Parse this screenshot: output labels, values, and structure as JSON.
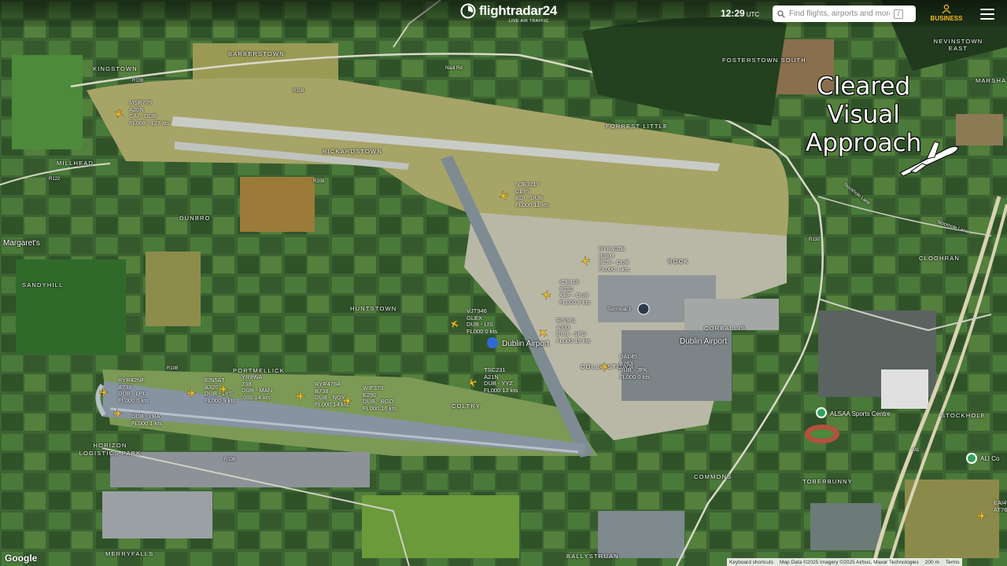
{
  "header": {
    "brand": "flightradar24",
    "tagline": "LIVE AIR TRAFFIC",
    "time": "12:29",
    "time_zone": "UTC",
    "search_placeholder": "Find flights, airports and more",
    "search_shortcut": "/",
    "business_label": "BUSINESS"
  },
  "overlay": {
    "line1": "Cleared",
    "line2": "Visual",
    "line3": "Approach"
  },
  "places": [
    "BARBERSTOWN",
    "KINGSTOWN",
    "FOSTERSTOWN SOUTH",
    "NEVINSTOWN EAST",
    "MARSHA",
    "FORREST LITTLE",
    "RICKARDSTOWN",
    "MILLHEAD",
    "DUNBRO",
    "Margaret's",
    "SANDYHILL",
    "HUNTSTOWN",
    "ROCK",
    "CLOGHRAN",
    "Terminal 1",
    "CORBALLIS",
    "Dublin Airport",
    "Dublin Airport",
    "COLLINSTOWN",
    "PORTMELLICK",
    "COLTRY",
    "HORIZON LOGISTICS PARK",
    "COMMONS",
    "TOBERBUNNY",
    "STOCKHOLE",
    "ALSAA Sports Centre",
    "MERRYFALLS",
    "BALLYSTRUAN",
    "ALI Co"
  ],
  "roads": [
    "R108",
    "R108",
    "R108",
    "R108",
    "R108",
    "R122",
    "R132",
    "M1",
    "Naul Rd",
    "Stockhole Lane",
    "Stockhole Lane"
  ],
  "flights": [
    {
      "callsign": "MSR775",
      "type": "A20N",
      "route": "CAI - DUB",
      "alt": "FL008 \\ 127 kts"
    },
    {
      "callsign": "NJE321Y",
      "type": "CL35",
      "route": "EDI - DUB",
      "alt": "FL000 11 kts"
    },
    {
      "callsign": "RYR40ZB",
      "type": "B38M",
      "route": "BCN - DUB",
      "alt": "FL000 1 kts"
    },
    {
      "callsign": "ICE418",
      "type": "B752",
      "route": "KEF - DUB",
      "alt": "FL000 8 kts"
    },
    {
      "callsign": "VJT946",
      "type": "GLEX",
      "route": "DUB - LIS",
      "alt": "FL000 0 kts"
    },
    {
      "callsign": "EIN961",
      "type": "A333",
      "route": "DUB - SFO",
      "alt": "FL000 15 kts"
    },
    {
      "callsign": "DAL45",
      "type": "B763",
      "route": "DUB - JFK",
      "alt": "FL000 0 kts"
    },
    {
      "callsign": "TSC231",
      "type": "A21N",
      "route": "DUB - YYZ",
      "alt": "FL000 12 kts"
    },
    {
      "callsign": "RYR42NF",
      "type": "B738",
      "route": "DUB - LPL",
      "alt": "FL000 0 kts"
    },
    {
      "callsign": "",
      "type": "",
      "route": "DUB - LBA",
      "alt": "FL000 1 kts"
    },
    {
      "callsign": "EIN5AT",
      "type": "A320",
      "route": "DUB - LYS",
      "alt": "FL000 9 kts"
    },
    {
      "callsign": "YR9WA",
      "type": "738",
      "route": "DUB - MAN",
      "alt": ".000 14 kts"
    },
    {
      "callsign": "RYR4784",
      "type": "B738",
      "route": "DUB - NQY",
      "alt": "FL000 14 kts"
    },
    {
      "callsign": "WIF373",
      "type": "E290",
      "route": "DUB - BGO",
      "alt": "FL000 16 kts"
    },
    {
      "callsign": "EAI4",
      "type": "AT76",
      "route": "",
      "alt": ""
    }
  ],
  "footer": {
    "google": "Google",
    "keyboard": "Keyboard shortcuts",
    "data": "Map Data ©2025 Imagery ©2025 Airbus, Maxar Technologies",
    "scale": "200 m",
    "terms": "Terms"
  },
  "colors": {
    "plane": "#f7c531",
    "poi": "#2ea35a",
    "business": "#f6b81f"
  }
}
